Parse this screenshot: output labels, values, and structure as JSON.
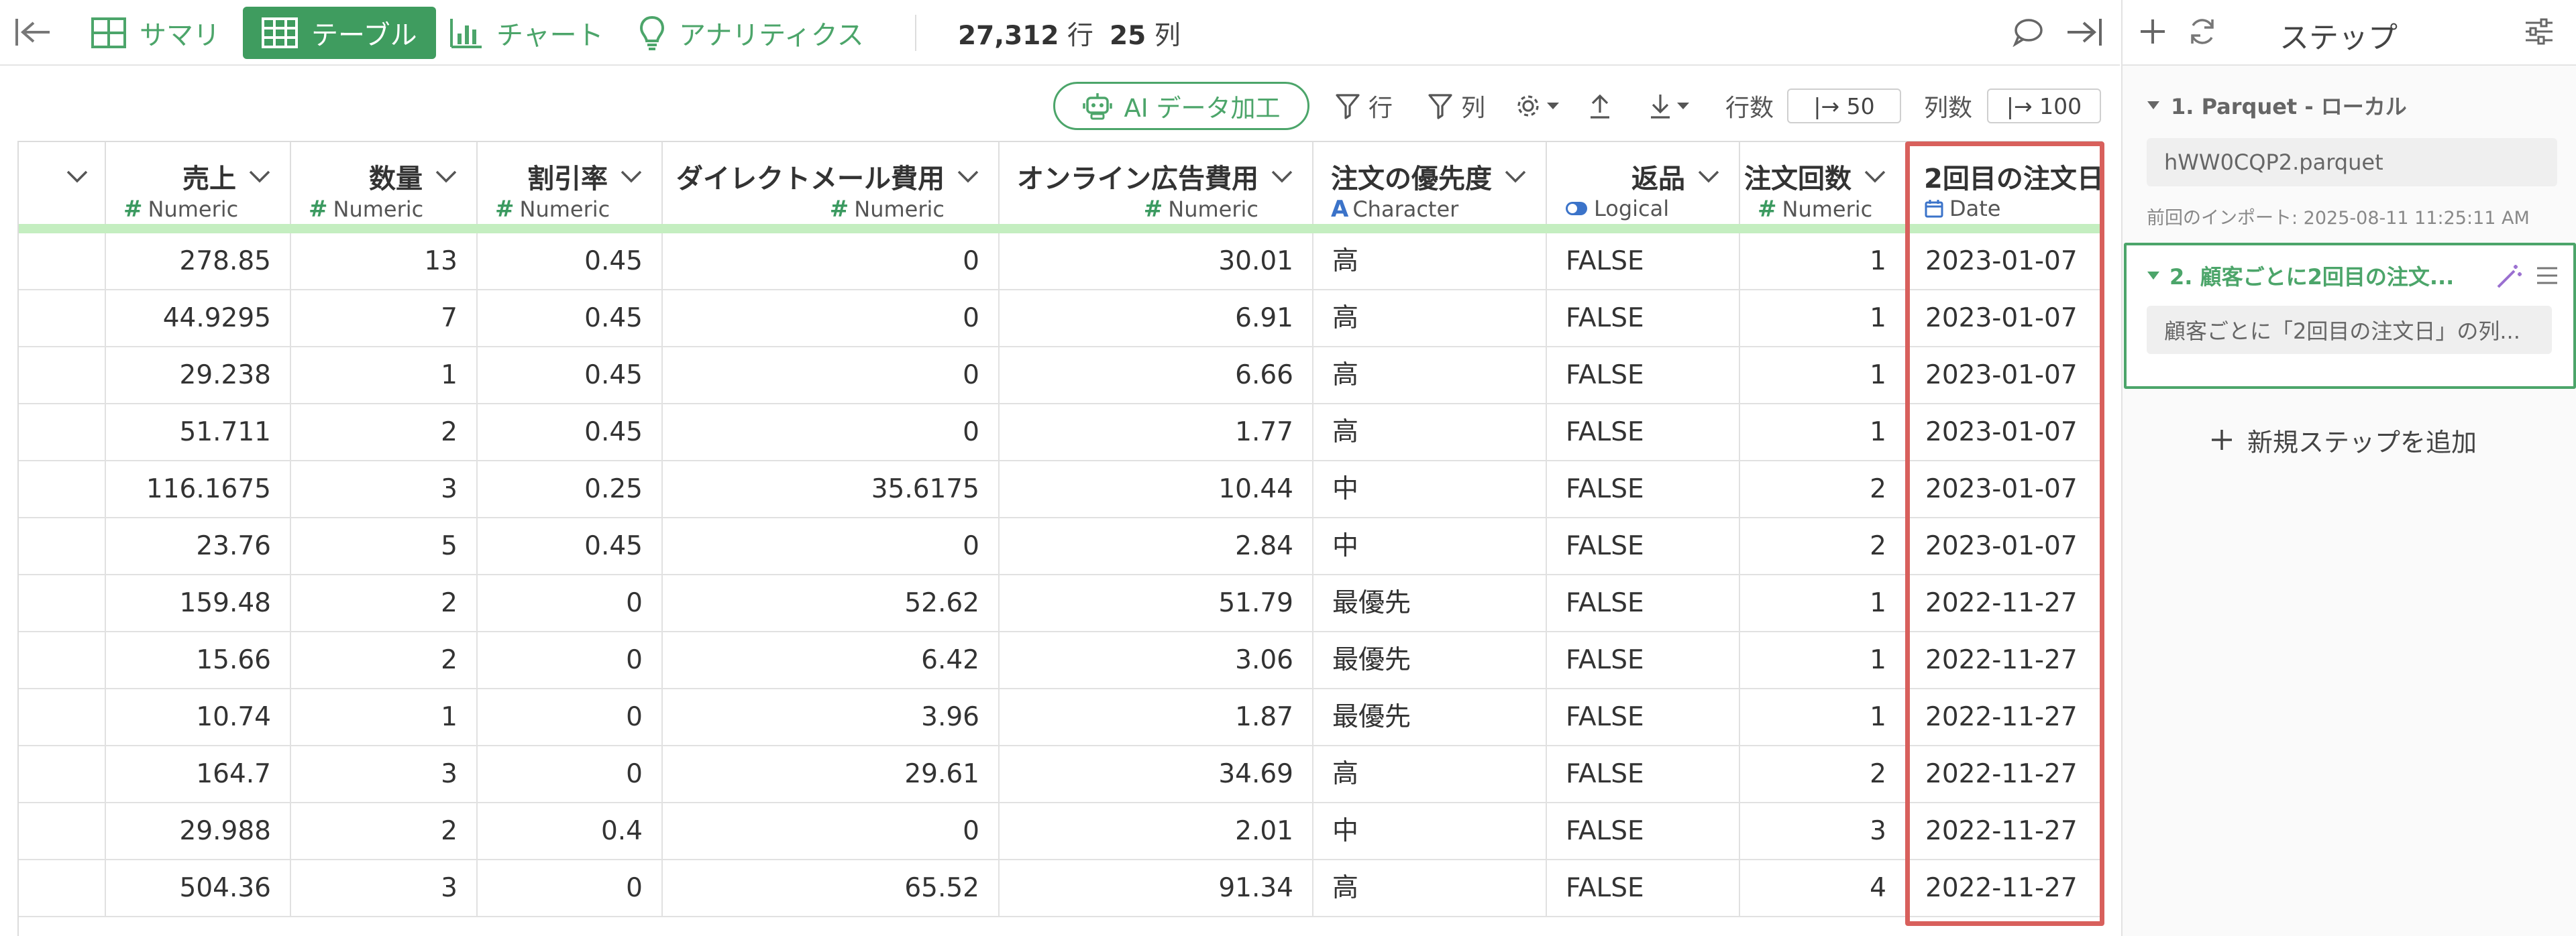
{
  "toolbar": {
    "tabs": [
      {
        "label": "サマリ",
        "active": false
      },
      {
        "label": "テーブル",
        "active": true
      },
      {
        "label": "チャート",
        "active": false
      },
      {
        "label": "アナリティクス",
        "active": false
      }
    ],
    "row_count": "27,312",
    "row_unit": "行",
    "col_count": "25",
    "col_unit": "列"
  },
  "subtoolbar": {
    "ai_label": "AI データ加工",
    "filter_rows_label": "行",
    "filter_cols_label": "列",
    "rows_label": "行数",
    "rows_limit": "|→ 50",
    "cols_label": "列数",
    "cols_limit": "|→ 100"
  },
  "steps": {
    "title": "ステップ",
    "step1": {
      "title": "1. Parquet - ローカル",
      "file": "hWW0CQP2.parquet",
      "import_note": "前回のインポート: 2025-08-11 11:25:11 AM"
    },
    "step2": {
      "title": "2. 顧客ごとに2回目の注文...",
      "description": "顧客ごとに「2回目の注文日」の列..."
    },
    "add_step_label": "新規ステップを追加"
  },
  "table": {
    "columns": [
      {
        "name": "売上",
        "type": "Numeric"
      },
      {
        "name": "数量",
        "type": "Numeric"
      },
      {
        "name": "割引率",
        "type": "Numeric"
      },
      {
        "name": "ダイレクトメール費用",
        "type": "Numeric"
      },
      {
        "name": "オンライン広告費用",
        "type": "Numeric"
      },
      {
        "name": "注文の優先度",
        "type": "Character"
      },
      {
        "name": "返品",
        "type": "Logical"
      },
      {
        "name": "注文回数",
        "type": "Numeric"
      },
      {
        "name": "2回目の注文日",
        "type": "Date"
      }
    ],
    "rows": [
      [
        "278.85",
        "13",
        "0.45",
        "0",
        "30.01",
        "高",
        "FALSE",
        "1",
        "2023-01-07"
      ],
      [
        "44.9295",
        "7",
        "0.45",
        "0",
        "6.91",
        "高",
        "FALSE",
        "1",
        "2023-01-07"
      ],
      [
        "29.238",
        "1",
        "0.45",
        "0",
        "6.66",
        "高",
        "FALSE",
        "1",
        "2023-01-07"
      ],
      [
        "51.711",
        "2",
        "0.45",
        "0",
        "1.77",
        "高",
        "FALSE",
        "1",
        "2023-01-07"
      ],
      [
        "116.1675",
        "3",
        "0.25",
        "35.6175",
        "10.44",
        "中",
        "FALSE",
        "2",
        "2023-01-07"
      ],
      [
        "23.76",
        "5",
        "0.45",
        "0",
        "2.84",
        "中",
        "FALSE",
        "2",
        "2023-01-07"
      ],
      [
        "159.48",
        "2",
        "0",
        "52.62",
        "51.79",
        "最優先",
        "FALSE",
        "1",
        "2022-11-27"
      ],
      [
        "15.66",
        "2",
        "0",
        "6.42",
        "3.06",
        "最優先",
        "FALSE",
        "1",
        "2022-11-27"
      ],
      [
        "10.74",
        "1",
        "0",
        "3.96",
        "1.87",
        "最優先",
        "FALSE",
        "1",
        "2022-11-27"
      ],
      [
        "164.7",
        "3",
        "0",
        "29.61",
        "34.69",
        "高",
        "FALSE",
        "2",
        "2022-11-27"
      ],
      [
        "29.988",
        "2",
        "0.4",
        "0",
        "2.01",
        "中",
        "FALSE",
        "3",
        "2022-11-27"
      ],
      [
        "504.36",
        "3",
        "0",
        "65.52",
        "91.34",
        "高",
        "FALSE",
        "4",
        "2022-11-27"
      ]
    ]
  },
  "colors": {
    "accent_green": "#3f9c5f",
    "highlight_red": "#d8605c",
    "quality_bar": "#c4eec0"
  }
}
